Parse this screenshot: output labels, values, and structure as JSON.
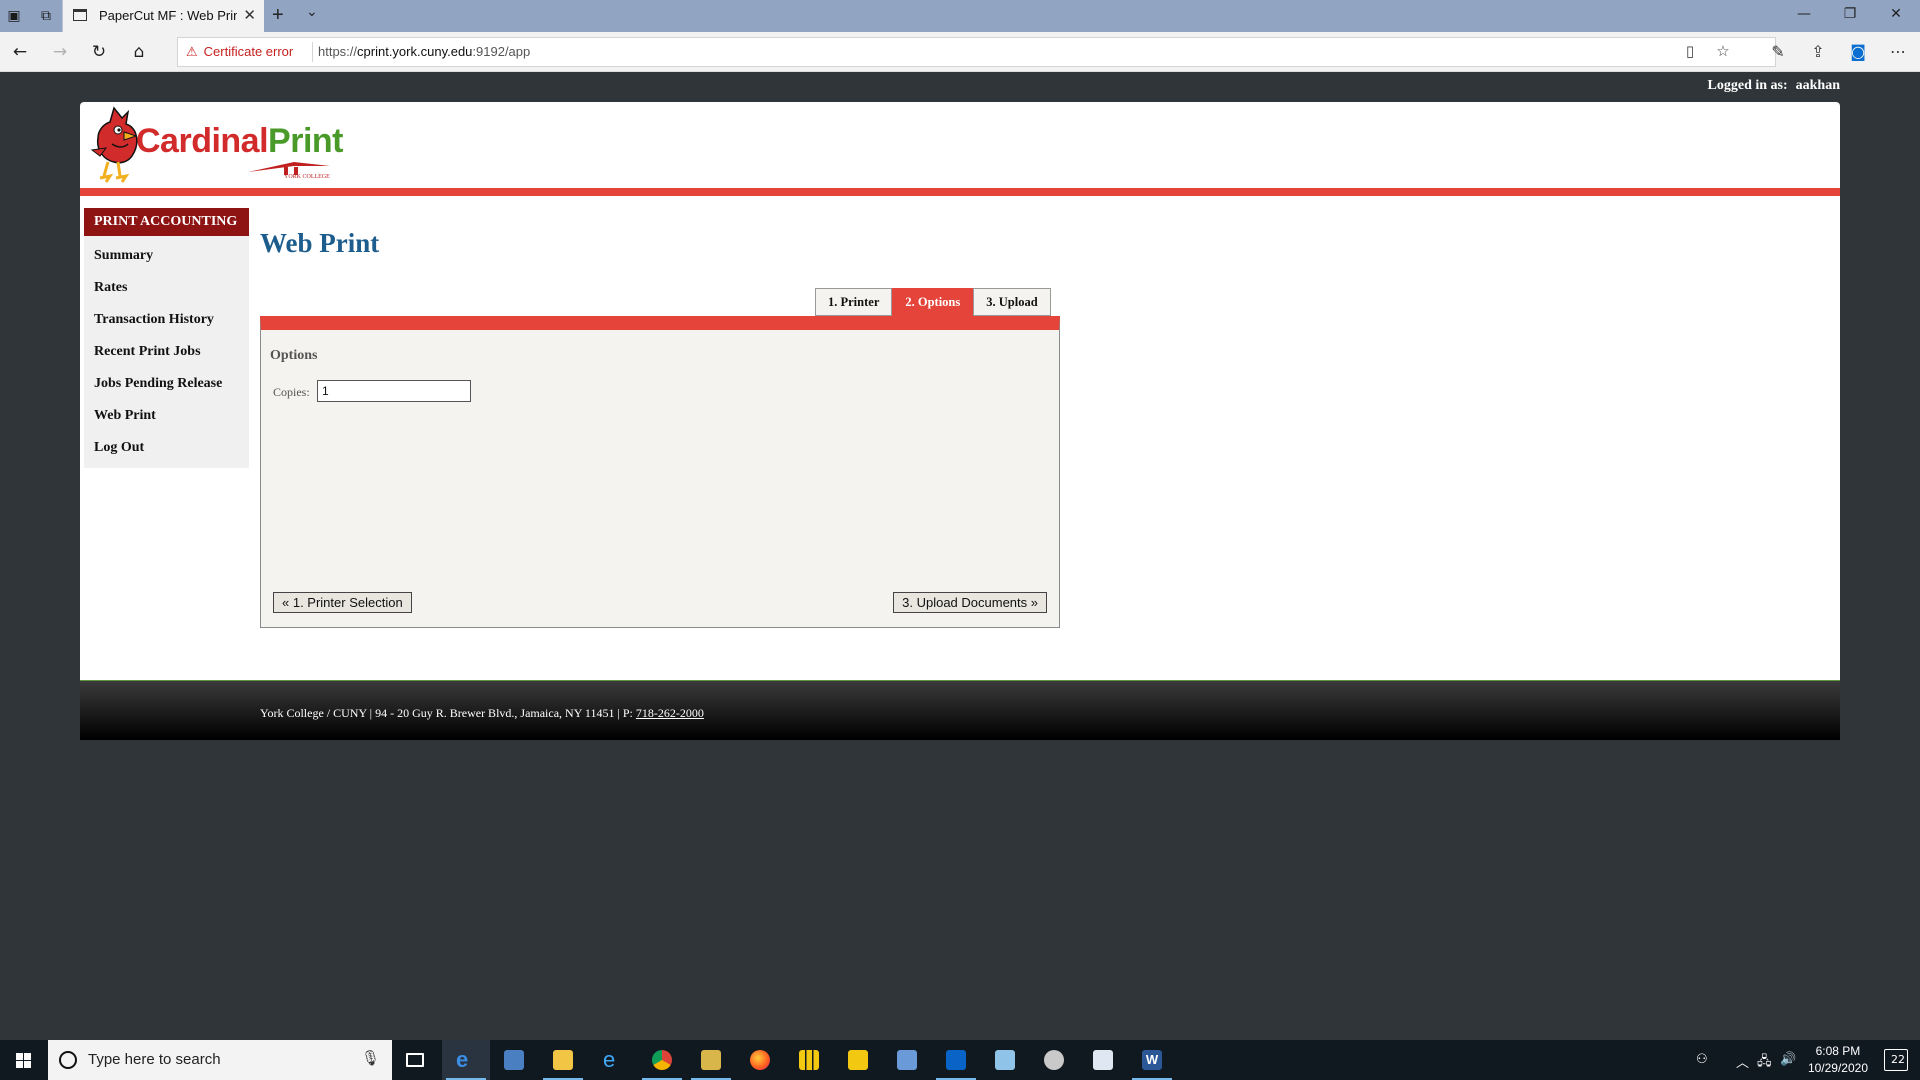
{
  "browser": {
    "tab_title": "PaperCut MF : Web Prin",
    "cert_warning": "Certificate error",
    "url_prefix": "https://",
    "url_host": "cprint.york.cuny.edu",
    "url_rest": ":9192/app"
  },
  "page": {
    "logged_in_label": "Logged in as:",
    "username": "aakhan",
    "logo": {
      "part1": "Cardinal",
      "part2": "Print",
      "subtitle": "YORK COLLEGE"
    },
    "sidebar": {
      "heading": "PRINT ACCOUNTING",
      "items": [
        {
          "label": "Summary"
        },
        {
          "label": "Rates"
        },
        {
          "label": "Transaction History"
        },
        {
          "label": "Recent Print Jobs"
        },
        {
          "label": "Jobs Pending Release"
        },
        {
          "label": "Web Print"
        },
        {
          "label": "Log Out"
        }
      ]
    },
    "title": "Web Print",
    "steps": [
      {
        "label": "1. Printer",
        "active": false
      },
      {
        "label": "2. Options",
        "active": true
      },
      {
        "label": "3. Upload",
        "active": false
      }
    ],
    "options": {
      "heading": "Options",
      "copies_label": "Copies:",
      "copies_value": "1"
    },
    "buttons": {
      "prev": "« 1. Printer Selection",
      "next": "3. Upload Documents »"
    },
    "footer": {
      "address": "York College / CUNY | 94 - 20 Guy R. Brewer Blvd., Jamaica, NY 11451 | P:",
      "phone": "718-262-2000"
    },
    "colors": {
      "accent_red": "#e5443a",
      "sidebar_head": "#8e1414",
      "title_blue": "#1d5d8e",
      "logo_green": "#4a9a2a"
    }
  },
  "taskbar": {
    "search_placeholder": "Type here to search",
    "time": "6:08 PM",
    "date": "10/29/2020",
    "notifications": "22",
    "apps": [
      {
        "name": "task-view-icon"
      },
      {
        "name": "edge-icon"
      },
      {
        "name": "remote-desktop-icon"
      },
      {
        "name": "file-explorer-icon"
      },
      {
        "name": "internet-explorer-icon"
      },
      {
        "name": "chrome-icon"
      },
      {
        "name": "sticky-app-icon"
      },
      {
        "name": "firefox-icon"
      },
      {
        "name": "power-bi-icon"
      },
      {
        "name": "power-bi-desktop-icon"
      },
      {
        "name": "network-app-icon"
      },
      {
        "name": "outlook-icon"
      },
      {
        "name": "notepad-icon"
      },
      {
        "name": "paint-icon"
      },
      {
        "name": "window-app-icon"
      },
      {
        "name": "word-icon"
      }
    ]
  }
}
